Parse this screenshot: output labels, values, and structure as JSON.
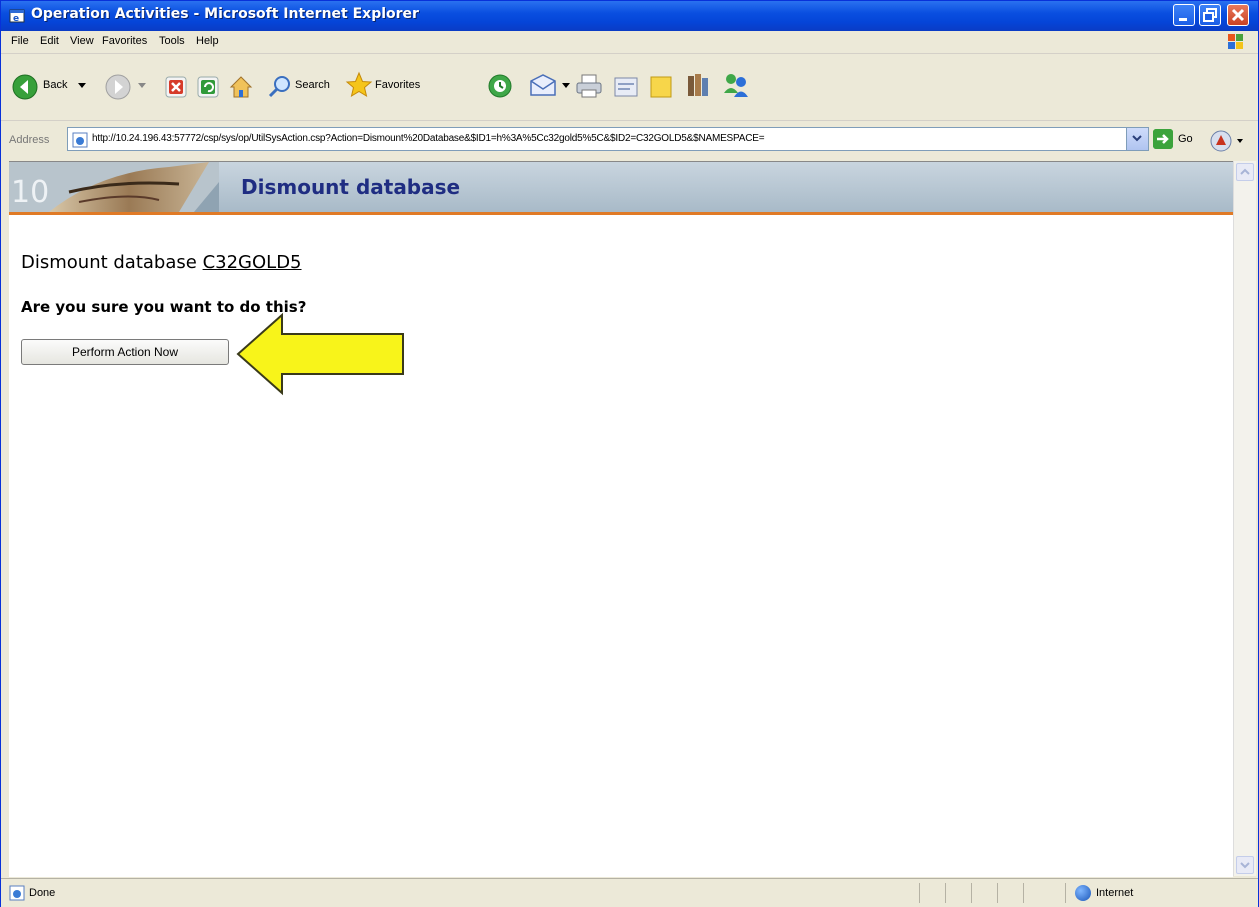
{
  "window": {
    "title": "Operation Activities - Microsoft Internet Explorer"
  },
  "menu": {
    "file": "File",
    "edit": "Edit",
    "view": "View",
    "favorites": "Favorites",
    "tools": "Tools",
    "help": "Help"
  },
  "toolbar": {
    "back": "Back",
    "search": "Search",
    "favorites": "Favorites"
  },
  "address": {
    "label": "Address",
    "url": "http://10.24.196.43:57772/csp/sys/op/UtilSysAction.csp?Action=Dismount%20Database&$ID1=h%3A%5Cc32gold5%5C&$ID2=C32GOLD5&$NAMESPACE=",
    "go": "Go"
  },
  "page": {
    "banner_title": "Dismount database",
    "heading_prefix": "Dismount database",
    "db_name": "C32GOLD5",
    "question": "Are you sure you want to do this?",
    "action_button": "Perform Action Now"
  },
  "status": {
    "text": "Done",
    "zone": "Internet"
  }
}
